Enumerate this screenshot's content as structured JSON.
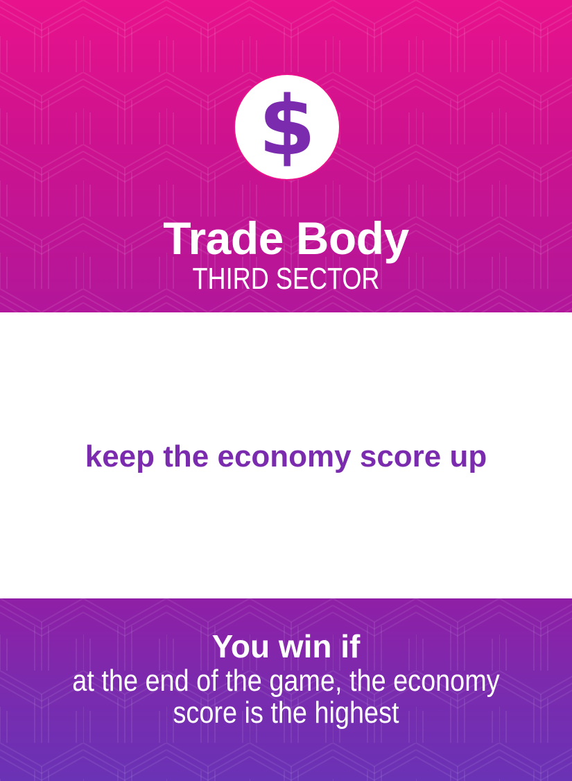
{
  "card": {
    "icon": "dollar-sign-icon",
    "icon_glyph": "$",
    "title": "Trade Body",
    "subtitle": "THIRD SECTOR",
    "goal": "keep the economy score up",
    "win_heading": "You win if",
    "win_condition": "at the end of the game, the economy score is the highest"
  },
  "colors": {
    "top_band": "#e8128c",
    "bottom_band": "#7a2bae",
    "accent_purple": "#7a2bae",
    "background": "#ffffff"
  }
}
